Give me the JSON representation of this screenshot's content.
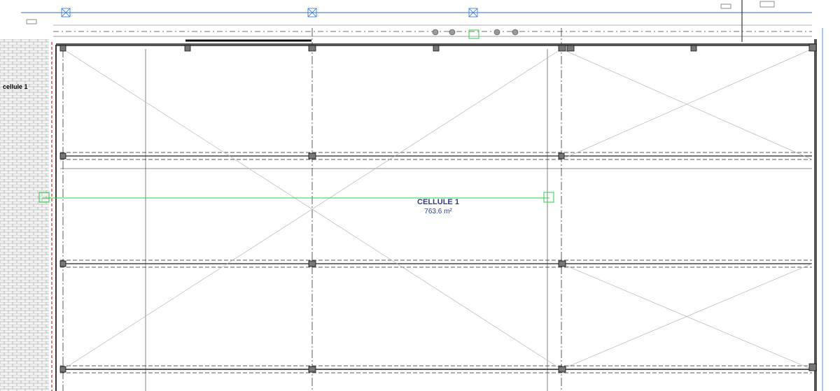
{
  "plan": {
    "cell_name": "CELLULE 1",
    "cell_area": "763.6 m²",
    "side_label": "cellule 1"
  },
  "colors": {
    "structure": "#2a2a2a",
    "grid": "#444444",
    "annotation_green": "#2bd14a",
    "annotation_blue": "#2a6fd6",
    "firewall_red": "#d9534f",
    "cell_text": "#2a3e8c"
  }
}
